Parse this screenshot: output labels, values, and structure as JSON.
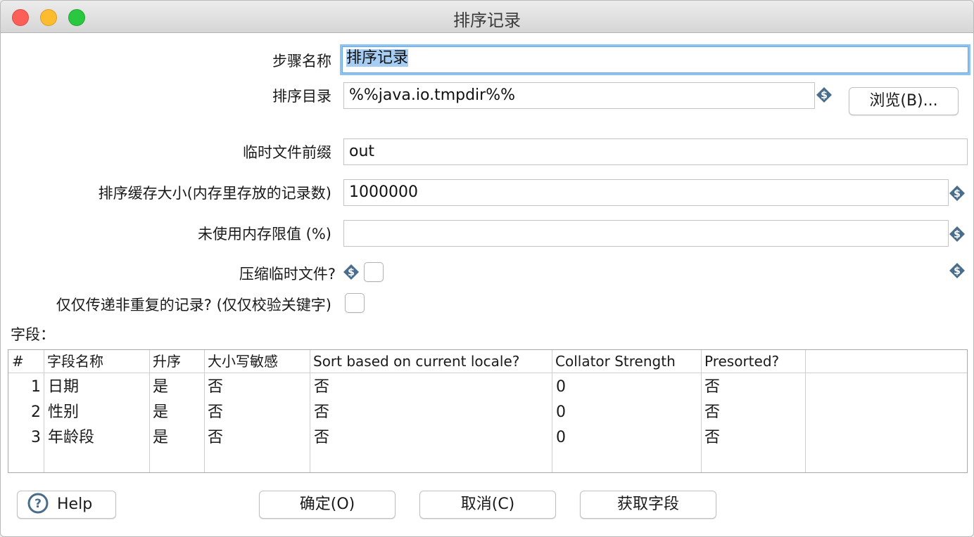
{
  "window": {
    "title": "排序记录"
  },
  "form": {
    "step_name_label": "步骤名称",
    "step_name_value": "排序记录",
    "sort_dir_label": "排序目录",
    "sort_dir_value": "%%java.io.tmpdir%%",
    "browse_button": "浏览(B)...",
    "temp_prefix_label": "临时文件前缀",
    "temp_prefix_value": "out",
    "sort_size_label": "排序缓存大小(内存里存放的记录数)",
    "sort_size_value": "1000000",
    "free_memory_label": "未使用内存限值 (%)",
    "free_memory_value": "",
    "compress_label": "压缩临时文件?",
    "compress_checked": false,
    "unique_label": "仅仅传递非重复的记录? (仅仅校验关键字)",
    "unique_checked": false
  },
  "fields": {
    "label": "字段：",
    "columns": [
      "#",
      "字段名称",
      "升序",
      "大小写敏感",
      "Sort based on current locale?",
      "Collator Strength",
      "Presorted?"
    ],
    "rows": [
      {
        "num": "1",
        "name": "日期",
        "asc": "是",
        "case": "否",
        "locale": "否",
        "strength": "0",
        "presorted": "否"
      },
      {
        "num": "2",
        "name": "性别",
        "asc": "是",
        "case": "否",
        "locale": "否",
        "strength": "0",
        "presorted": "否"
      },
      {
        "num": "3",
        "name": "年龄段",
        "asc": "是",
        "case": "否",
        "locale": "否",
        "strength": "0",
        "presorted": "否"
      }
    ]
  },
  "buttons": {
    "help": "Help",
    "ok": "确定(O)",
    "cancel": "取消(C)",
    "get_fields": "获取字段"
  },
  "icons": {
    "variable": "variable-dollar-icon",
    "help": "help-circle-icon"
  },
  "colors": {
    "focus_ring": "#8cc3f5",
    "selection": "#a6cdf3",
    "variable_icon": "#4a6d8c"
  }
}
